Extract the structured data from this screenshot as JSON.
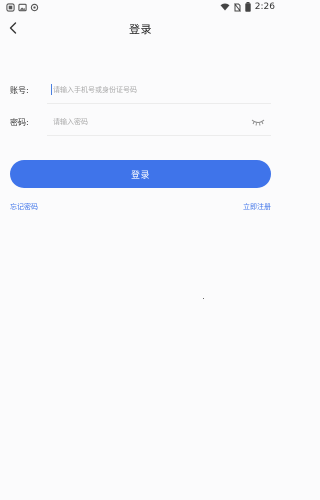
{
  "status_bar": {
    "time": "2:26",
    "icons": [
      "notification-icon",
      "image-icon",
      "sync-icon",
      "wifi-icon",
      "no-sim-icon",
      "battery-icon"
    ]
  },
  "header": {
    "title": "登录",
    "back_icon": "chevron-left-icon"
  },
  "form": {
    "account": {
      "label": "账号:",
      "placeholder": "请输入手机号或身份证号码",
      "value": ""
    },
    "password": {
      "label": "密码:",
      "placeholder": "请输入密码",
      "value": "",
      "toggle_icon": "eye-closed-icon"
    },
    "login_button": "登录",
    "forgot_password": "忘记密码",
    "register": "立即注册"
  },
  "colors": {
    "accent": "#3f74ea",
    "background": "#fbfbfc",
    "divider": "#ececec",
    "placeholder": "#a8a8a8"
  }
}
